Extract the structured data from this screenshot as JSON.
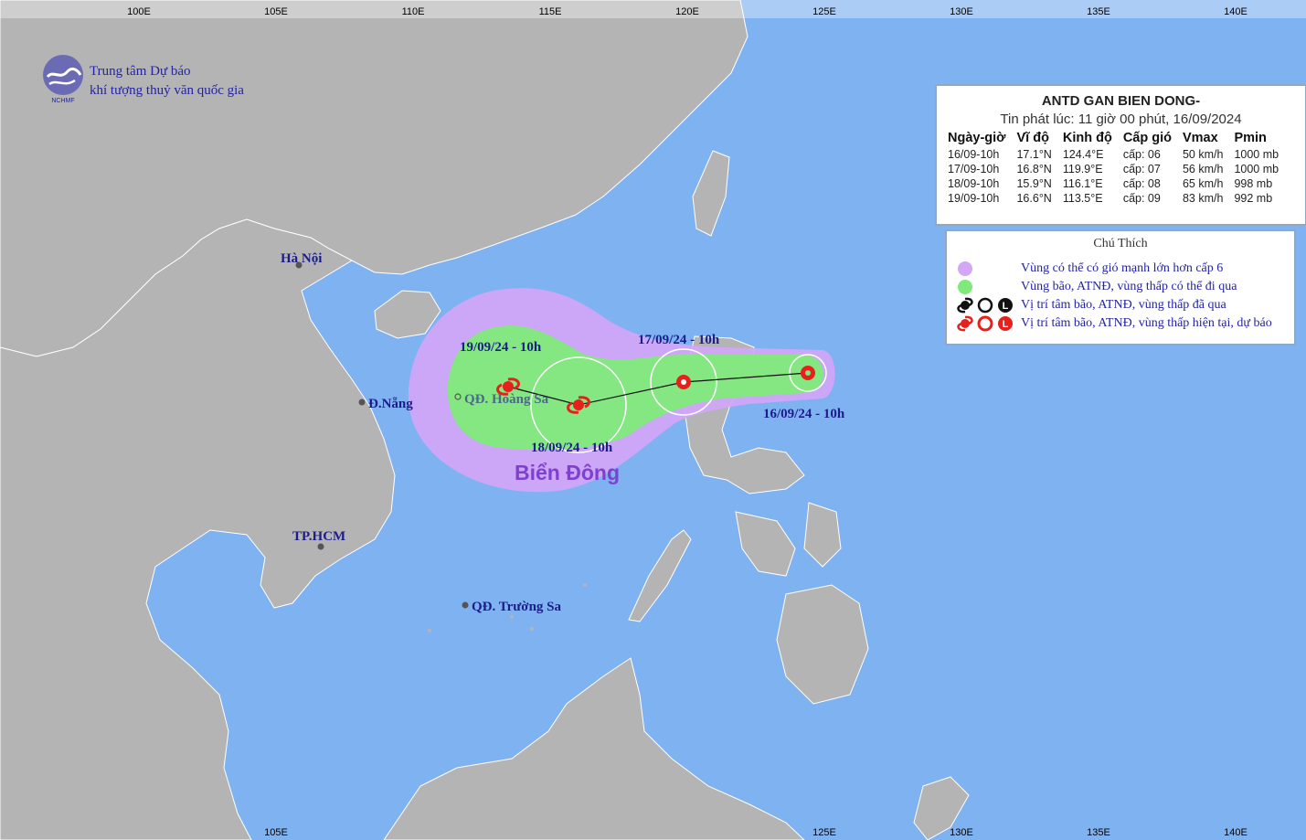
{
  "organization": {
    "line1": "Trung tâm Dự báo",
    "line2": "khí tượng thuỷ văn quốc gia",
    "logo_text": "NCHMF"
  },
  "axes": {
    "top_ticks": [
      "100E",
      "105E",
      "110E",
      "115E",
      "120E",
      "125E",
      "130E",
      "135E",
      "140E"
    ],
    "bottom_ticks": [
      "105E",
      "125E",
      "130E",
      "135E",
      "140E"
    ]
  },
  "bulletin": {
    "title": "ANTD GAN BIEN DONG-",
    "issued": "Tin phát lúc: 11 giờ 00 phút, 16/09/2024",
    "headers": [
      "Ngày-giờ",
      "Vĩ độ",
      "Kinh độ",
      "Cấp gió",
      "Vmax",
      "Pmin"
    ],
    "rows": [
      [
        "16/09-10h",
        "17.1°N",
        "124.4°E",
        "cấp: 06",
        "50 km/h",
        "1000 mb"
      ],
      [
        "17/09-10h",
        "16.8°N",
        "119.9°E",
        "cấp: 07",
        "56 km/h",
        "1000 mb"
      ],
      [
        "18/09-10h",
        "15.9°N",
        "116.1°E",
        "cấp: 08",
        "65 km/h",
        "998 mb"
      ],
      [
        "19/09-10h",
        "16.6°N",
        "113.5°E",
        "cấp: 09",
        "83 km/h",
        "992 mb"
      ]
    ]
  },
  "legend": {
    "title": "Chú Thích",
    "items": [
      {
        "text": "Vùng có thể có gió mạnh lớn hơn cấp 6",
        "color": "#d3a6f7",
        "icon": "purple-dot-icon"
      },
      {
        "text": "Vùng bão, ATNĐ, vùng thấp có thể đi qua",
        "color": "#7fea7a",
        "icon": "green-dot-icon"
      },
      {
        "text": "Vị trí tâm bão, ATNĐ, vùng thấp đã qua",
        "color": "#000000",
        "icon": "past-position-icons"
      },
      {
        "text": "Vị trí tâm bão, ATNĐ, vùng thấp hiện tại, dự báo",
        "color": "#e8201c",
        "icon": "forecast-position-icons"
      }
    ]
  },
  "places": {
    "hanoi": "Hà Nội",
    "danang": "Đ.Nẵng",
    "hcm": "TP.HCM",
    "hoangsa": "QĐ. Hoàng Sa",
    "truongsa": "QĐ. Trường Sa",
    "sea": "Biển Đông"
  },
  "track_labels": {
    "p1": "16/09/24 - 10h",
    "p2": "17/09/24 - 10h",
    "p3": "18/09/24 - 10h",
    "p4": "19/09/24 - 10h"
  },
  "colors": {
    "ocean": "#7fb2f0",
    "land": "#b4b4b4",
    "wind_zone": "#d3a6f7",
    "storm_zone": "#7fea7a",
    "track_symbol": "#e8201c"
  }
}
